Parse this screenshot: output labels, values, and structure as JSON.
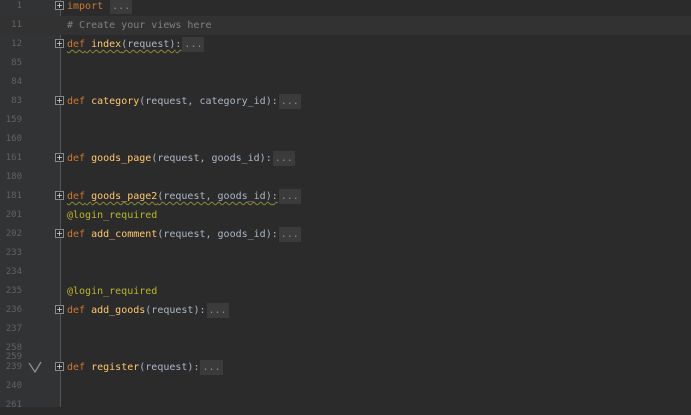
{
  "lines": [
    {
      "num": "1",
      "kind": "fold",
      "keyword": "import",
      "folded": "..."
    },
    {
      "num": "11",
      "kind": "comment",
      "text": "# Create your views here"
    },
    {
      "num": "12",
      "kind": "def",
      "keyword": "def",
      "name": "index",
      "params": "(request)",
      "colon": ":",
      "folded": "..."
    },
    {
      "num": "85",
      "kind": "blank"
    },
    {
      "num": "84",
      "kind": "blank"
    },
    {
      "num": "83",
      "kind": "def",
      "keyword": "def",
      "name": "category",
      "params": "(request, category_id)",
      "colon": ":",
      "folded": "..."
    },
    {
      "num": "159",
      "kind": "blank"
    },
    {
      "num": "160",
      "kind": "blank"
    },
    {
      "num": "161",
      "kind": "def",
      "keyword": "def",
      "name": "goods_page",
      "params": "(request, goods_id)",
      "colon": ":",
      "folded": "..."
    },
    {
      "num": "180",
      "kind": "blank"
    },
    {
      "num": "181",
      "kind": "def",
      "keyword": "def",
      "name": "goods_page2",
      "params": "(request, goods_id)",
      "colon": ":",
      "folded": "..."
    },
    {
      "num": "201",
      "kind": "decorator",
      "text": "@login_required"
    },
    {
      "num": "202",
      "kind": "def",
      "keyword": "def",
      "name": "add_comment",
      "params": "(request, goods_id)",
      "colon": ":",
      "folded": "..."
    },
    {
      "num": "233",
      "kind": "blank"
    },
    {
      "num": "234",
      "kind": "blank"
    },
    {
      "num": "235",
      "kind": "decorator",
      "text": "@login_required"
    },
    {
      "num": "236",
      "kind": "def",
      "keyword": "def",
      "name": "add_goods",
      "params": "(request)",
      "colon": ":",
      "folded": "..."
    },
    {
      "num": "237",
      "kind": "blank"
    },
    {
      "num": "258",
      "kind": "blank"
    },
    {
      "num": "259",
      "kind": "blank"
    },
    {
      "num": "239",
      "kind": "def",
      "keyword": "def",
      "name": "register",
      "params": "(request)",
      "colon": ":",
      "folded": "...",
      "bookmark": true
    },
    {
      "num": "240",
      "kind": "blank"
    },
    {
      "num": "261",
      "kind": "blank"
    }
  ],
  "colors": {
    "background": "#2b2b2b",
    "gutter": "#313335",
    "keyword": "#cc7832",
    "function": "#ffc66d",
    "decorator": "#bbb529",
    "comment": "#808080",
    "text": "#a9b7c6"
  }
}
